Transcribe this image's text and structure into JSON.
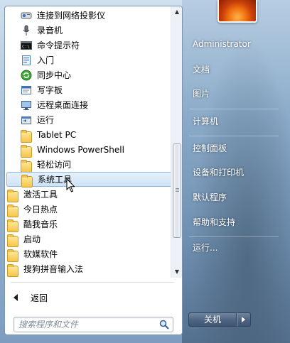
{
  "program_list": {
    "items": [
      {
        "label": "连接到网络投影仪",
        "icon": "projector-icon",
        "level": "sub"
      },
      {
        "label": "录音机",
        "icon": "microphone-icon",
        "level": "sub"
      },
      {
        "label": "命令提示符",
        "icon": "command-prompt-icon",
        "level": "sub"
      },
      {
        "label": "入门",
        "icon": "getting-started-icon",
        "level": "sub"
      },
      {
        "label": "同步中心",
        "icon": "sync-center-icon",
        "level": "sub"
      },
      {
        "label": "写字板",
        "icon": "wordpad-icon",
        "level": "sub"
      },
      {
        "label": "远程桌面连接",
        "icon": "remote-desktop-icon",
        "level": "sub"
      },
      {
        "label": "运行",
        "icon": "run-icon",
        "level": "sub"
      },
      {
        "label": "Tablet PC",
        "icon": "folder-icon",
        "level": "sub"
      },
      {
        "label": "Windows PowerShell",
        "icon": "folder-icon",
        "level": "sub"
      },
      {
        "label": "轻松访问",
        "icon": "folder-icon",
        "level": "sub"
      },
      {
        "label": "系统工具",
        "icon": "folder-icon",
        "level": "sub",
        "selected": true
      },
      {
        "label": "激活工具",
        "icon": "folder-icon",
        "level": "top"
      },
      {
        "label": "今日热点",
        "icon": "folder-icon",
        "level": "top"
      },
      {
        "label": "酷我音乐",
        "icon": "folder-icon",
        "level": "top"
      },
      {
        "label": "启动",
        "icon": "folder-icon",
        "level": "top"
      },
      {
        "label": "软媒软件",
        "icon": "folder-icon",
        "level": "top"
      },
      {
        "label": "搜狗拼音输入法",
        "icon": "folder-icon",
        "level": "top"
      }
    ]
  },
  "back": {
    "label": "返回"
  },
  "search": {
    "placeholder": "搜索程序和文件"
  },
  "right_menu": {
    "user": "Administrator",
    "documents": "文档",
    "pictures": "图片",
    "computer": "计算机",
    "control_panel": "控制面板",
    "devices_printers": "设备和打印机",
    "default_programs": "默认程序",
    "help_support": "帮助和支持",
    "run": "运行..."
  },
  "shutdown": {
    "label": "关机"
  },
  "colors": {
    "selection": "#cfe3f6",
    "panel": "#ffffff",
    "accent_text": "#ffffff"
  }
}
